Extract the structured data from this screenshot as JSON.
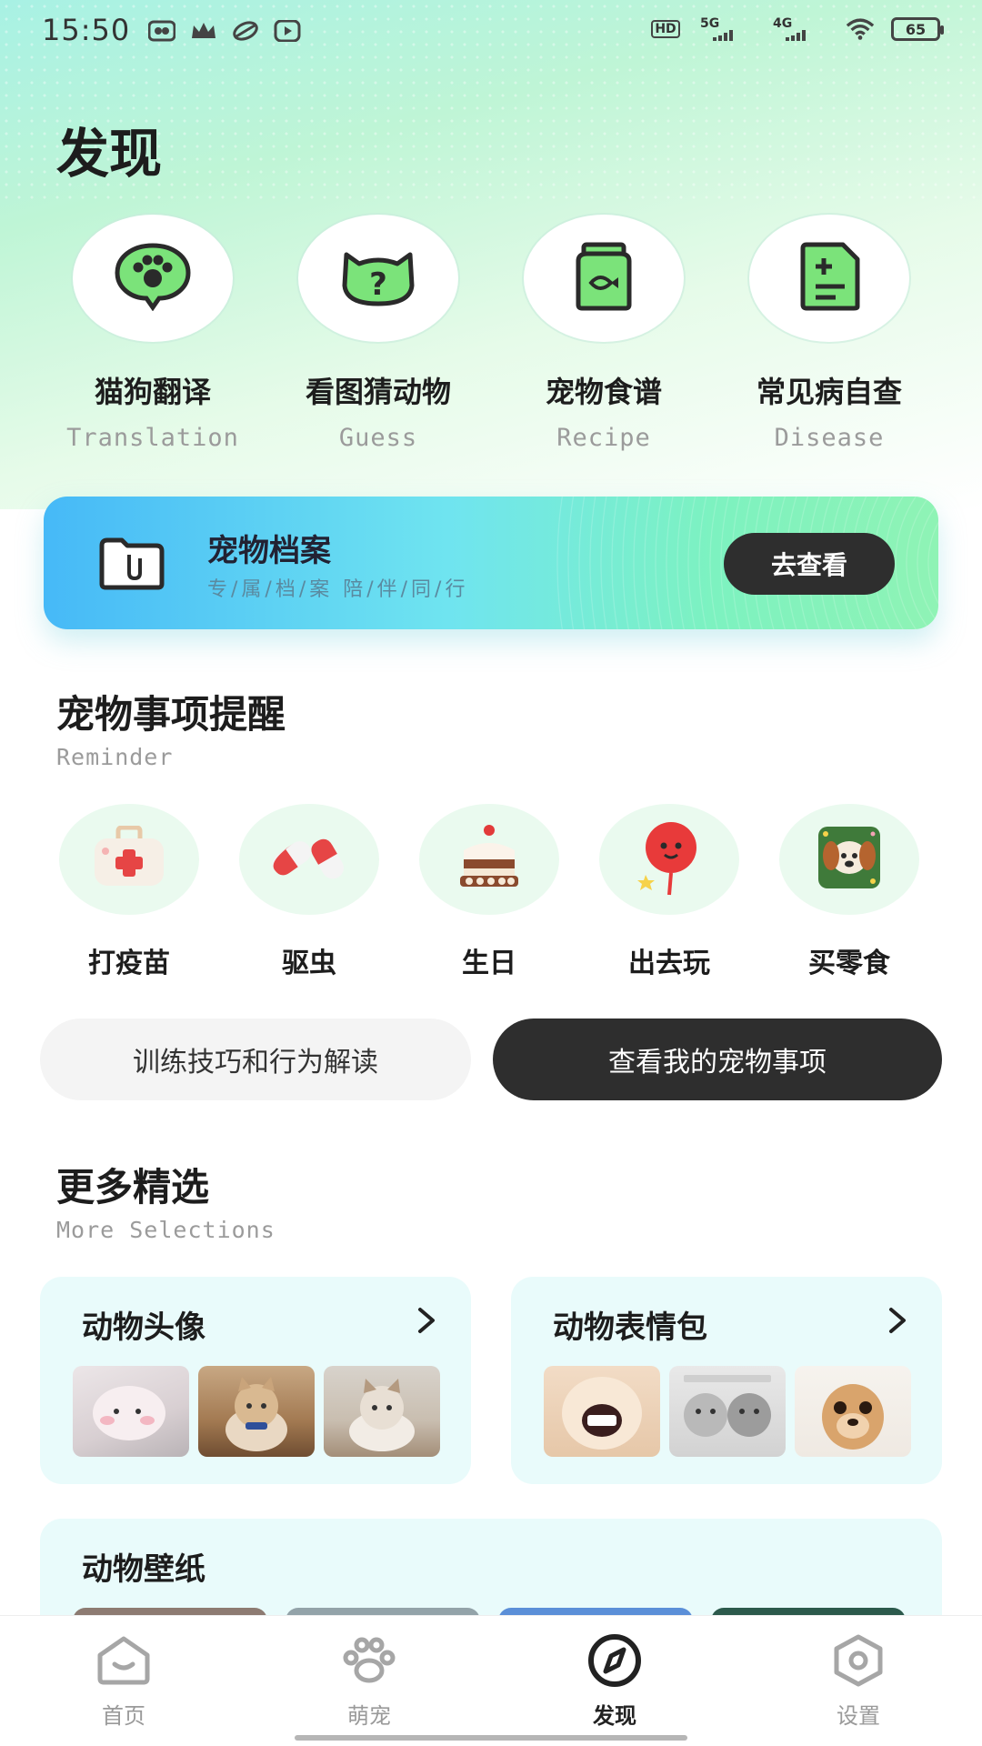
{
  "status_bar": {
    "time": "15:50",
    "battery": "65",
    "hd_label": "HD",
    "net_5g": "5G",
    "net_4g": "4G"
  },
  "page": {
    "title": "发现"
  },
  "tools": [
    {
      "cn": "猫狗翻译",
      "en": "Translation",
      "icon": "paw-chat-icon"
    },
    {
      "cn": "看图猜动物",
      "en": "Guess",
      "icon": "cat-question-icon"
    },
    {
      "cn": "宠物食谱",
      "en": "Recipe",
      "icon": "fish-food-bag-icon"
    },
    {
      "cn": "常见病自查",
      "en": "Disease",
      "icon": "medical-report-icon"
    }
  ],
  "banner": {
    "title": "宠物档案",
    "subtitle": "专/属/档/案 陪/伴/同/行",
    "button": "去查看"
  },
  "reminder": {
    "title": "宠物事项提醒",
    "subtitle": "Reminder",
    "items": [
      {
        "label": "打疫苗",
        "icon": "medical-kit-icon"
      },
      {
        "label": "驱虫",
        "icon": "pill-capsule-icon"
      },
      {
        "label": "生日",
        "icon": "birthday-cake-icon"
      },
      {
        "label": "出去玩",
        "icon": "balloon-icon"
      },
      {
        "label": "买零食",
        "icon": "dog-snack-bag-icon"
      }
    ],
    "left_button": "训练技巧和行为解读",
    "right_button": "查看我的宠物事项"
  },
  "more": {
    "title": "更多精选",
    "subtitle": "More Selections",
    "cards": [
      {
        "title": "动物头像"
      },
      {
        "title": "动物表情包"
      }
    ],
    "wallpaper_title": "动物壁纸"
  },
  "nav": [
    {
      "label": "首页",
      "icon": "home-icon",
      "active": false
    },
    {
      "label": "萌宠",
      "icon": "paw-icon",
      "active": false
    },
    {
      "label": "发现",
      "icon": "compass-icon",
      "active": true
    },
    {
      "label": "设置",
      "icon": "settings-hexagon-icon",
      "active": false
    }
  ],
  "colors": {
    "accent_dark": "#2e2e2e",
    "accent_green": "#7be37a",
    "banner_start": "#46b9f7",
    "banner_end": "#8ff3b5"
  }
}
